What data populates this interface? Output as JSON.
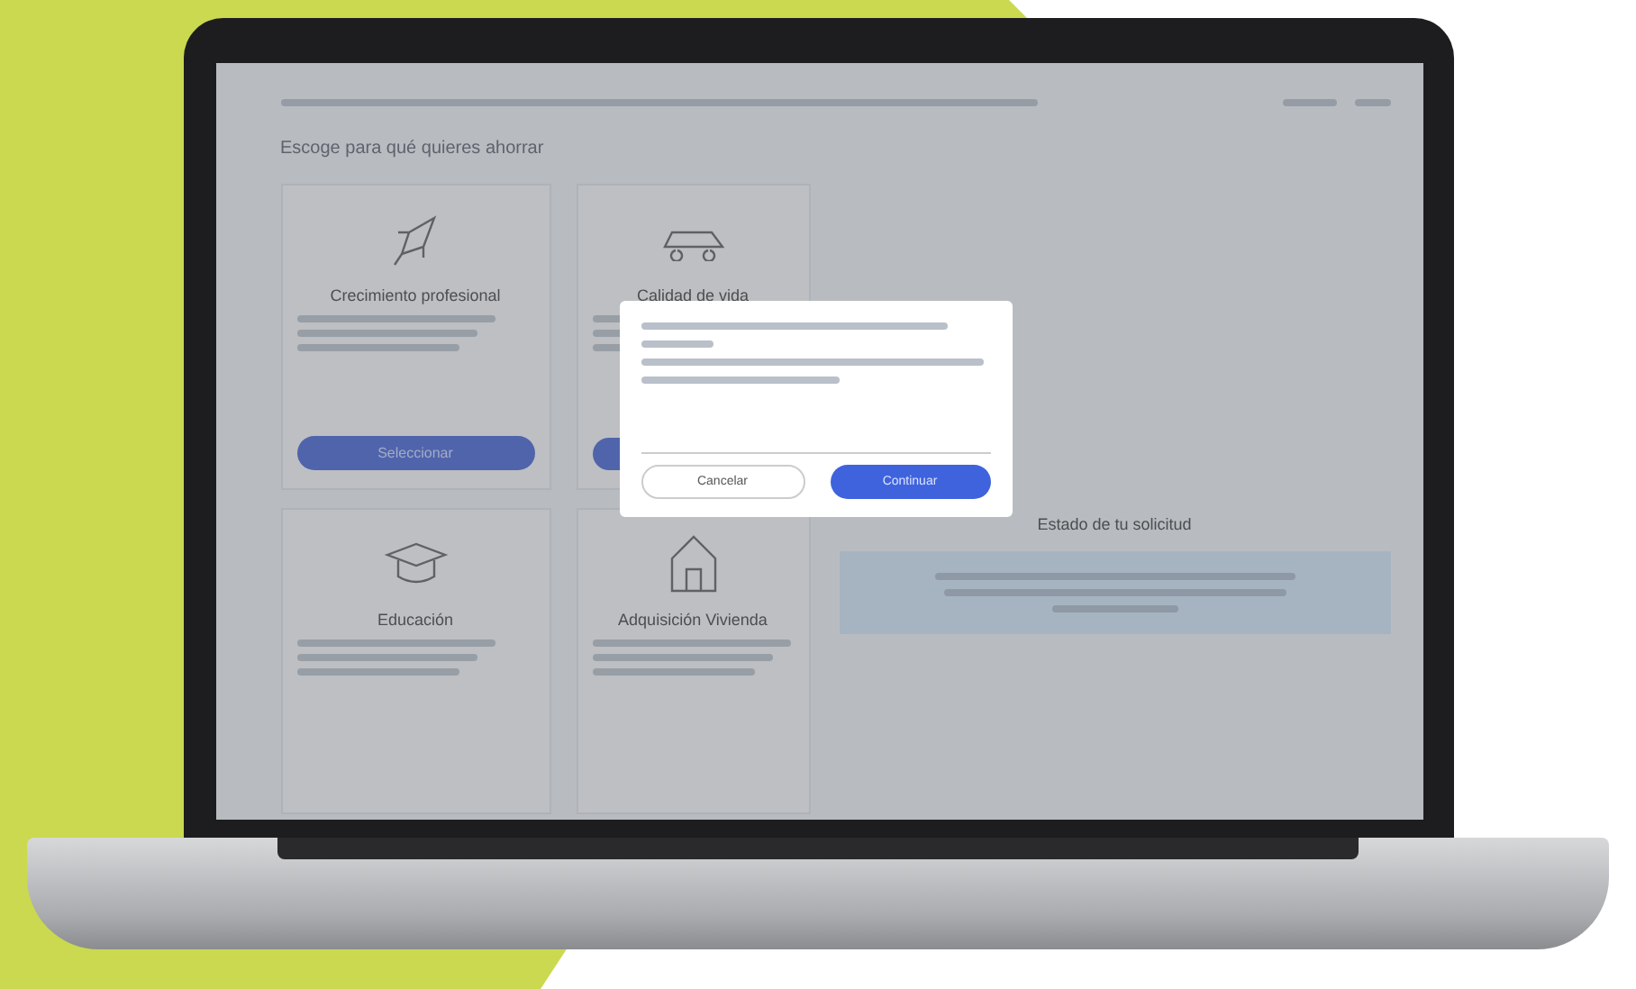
{
  "screen": {
    "title": "Escoge para qué quieres ahorrar",
    "cards": [
      {
        "kind": "rocket",
        "title": "Crecimiento profesional",
        "button": "Seleccionar"
      },
      {
        "kind": "car",
        "title": "Calidad de vida",
        "covered_button": true
      },
      {
        "kind": "cap",
        "title": "Educación"
      },
      {
        "kind": "house",
        "title": "Adquisición Vivienda"
      }
    ],
    "status": {
      "title": "Estado de tu solicitud"
    },
    "modal": {
      "cancel": "Cancelar",
      "confirm": "Continuar"
    }
  }
}
